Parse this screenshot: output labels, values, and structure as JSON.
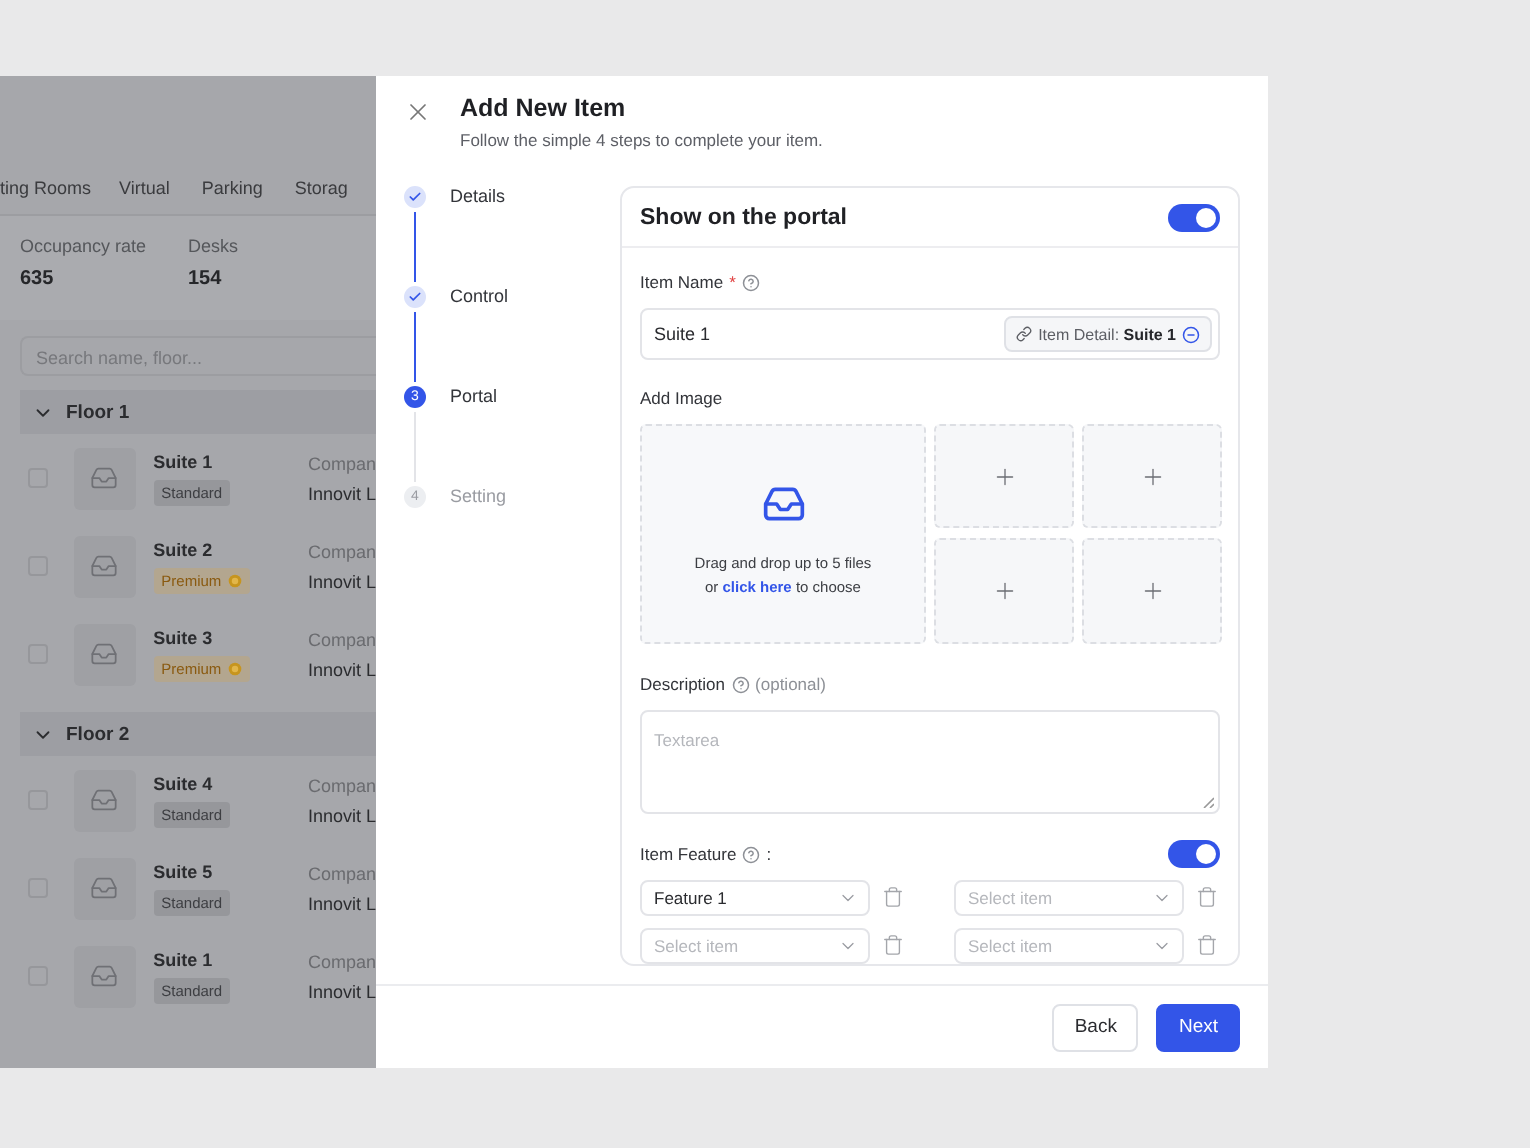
{
  "background_app": {
    "tabs": [
      "ting Rooms",
      "Virtual",
      "Parking",
      "Storag"
    ],
    "stats": [
      {
        "label": "Occupancy rate",
        "value": "635"
      },
      {
        "label": "Desks",
        "value": "154"
      }
    ],
    "search": {
      "placeholder": "Search name, floor..."
    },
    "groups": [
      {
        "title": "Floor 1",
        "expanded": true,
        "rows": [
          {
            "name": "Suite 1",
            "tier": "Standard",
            "kind": "standard",
            "checked": false,
            "column_3_label": "Compan",
            "column_3_value": "Innovit L"
          },
          {
            "name": "Suite 2",
            "tier": "Premium",
            "kind": "premium",
            "checked": false,
            "column_3_label": "Compan",
            "column_3_value": "Innovit L"
          },
          {
            "name": "Suite 3",
            "tier": "Premium",
            "kind": "premium",
            "checked": false,
            "column_3_label": "Compan",
            "column_3_value": "Innovit L"
          }
        ]
      },
      {
        "title": "Floor 2",
        "expanded": true,
        "rows": [
          {
            "name": "Suite 4",
            "tier": "Standard",
            "kind": "standard",
            "checked": false,
            "column_3_label": "Compan",
            "column_3_value": "Innovit L"
          },
          {
            "name": "Suite 5",
            "tier": "Standard",
            "kind": "standard",
            "checked": false,
            "column_3_label": "Compan",
            "column_3_value": "Innovit L"
          },
          {
            "name": "Suite 1",
            "tier": "Standard",
            "kind": "standard",
            "checked": false,
            "column_3_label": "Compan",
            "column_3_value": "Innovit L"
          }
        ]
      }
    ]
  },
  "modal": {
    "title": "Add New Item",
    "subtitle": "Follow the simple 4 steps to complete your item.",
    "steps": [
      {
        "label": "Details",
        "done": true,
        "current": false
      },
      {
        "label": "Control",
        "done": true,
        "current": false
      },
      {
        "number": "3",
        "label": "Portal",
        "done": false,
        "current": true
      },
      {
        "number": "4",
        "label": "Setting",
        "done": false,
        "current": false
      }
    ],
    "portal": {
      "title": "Show on the portal",
      "on": true
    },
    "item_name": {
      "label": "Item Name",
      "required_mark": "*",
      "value": "Suite 1",
      "chip": "Item Detail: **Suite 1**"
    },
    "add_image": {
      "label": "Add Image",
      "hint_line": "Drag and drop up to 5 files",
      "hint_prefix": "or",
      "link": "click here",
      "hint_suffix": "to choose"
    },
    "description": {
      "label": "Description",
      "note": "(optional)",
      "placeholder": "Textarea"
    },
    "feature": {
      "label": "Item Feature",
      "suffix": ":",
      "on": true,
      "selects": [
        {
          "value": "Feature 1"
        },
        {
          "placeholder": "Select item"
        },
        {
          "placeholder": "Select item"
        },
        {
          "placeholder": "Select item"
        }
      ]
    },
    "buttons": [
      {
        "label": "Back",
        "kind": "secondary"
      },
      {
        "label": "Next",
        "kind": "primary"
      }
    ]
  }
}
